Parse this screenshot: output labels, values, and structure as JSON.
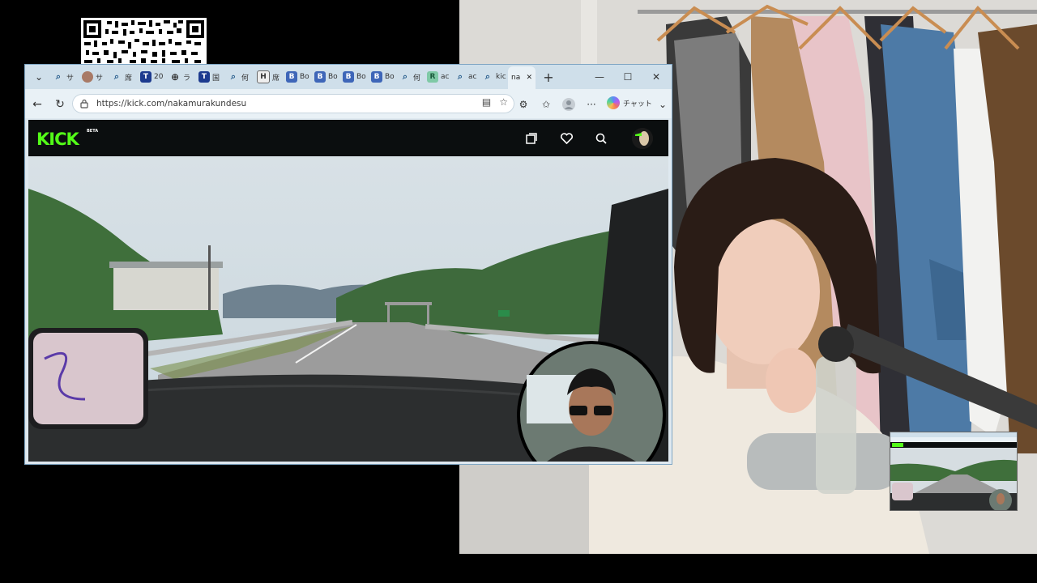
{
  "qr": {
    "icon": "qr-code-icon"
  },
  "browser": {
    "tabs": [
      {
        "icon": "search-icon",
        "label": "サ"
      },
      {
        "icon": "profile-icon",
        "label": "サ"
      },
      {
        "icon": "search-icon",
        "label": "席"
      },
      {
        "icon": "t-icon",
        "label": "20"
      },
      {
        "icon": "globe-icon",
        "label": "ラ"
      },
      {
        "icon": "t-icon",
        "label": "国"
      },
      {
        "icon": "search-icon",
        "label": "何"
      },
      {
        "icon": "h-icon",
        "label": "席"
      },
      {
        "icon": "b-icon",
        "label": "Bo"
      },
      {
        "icon": "b-icon",
        "label": "Bo"
      },
      {
        "icon": "b-icon",
        "label": "Bo"
      },
      {
        "icon": "b-icon",
        "label": "Bo"
      },
      {
        "icon": "search-icon",
        "label": "何"
      },
      {
        "icon": "r-icon",
        "label": "ac"
      },
      {
        "icon": "search-icon",
        "label": "ac"
      },
      {
        "icon": "search-icon",
        "label": "kic"
      }
    ],
    "active_tab": {
      "label": "na",
      "close": "✕"
    },
    "new_tab": "+",
    "window": {
      "minimize": "—",
      "maximize": "☐",
      "close": "✕"
    },
    "nav": {
      "back": "←",
      "refresh": "↻"
    },
    "address": {
      "url": "https://kick.com/nakamurakundesu"
    },
    "toolbar_right": {
      "more": "···",
      "copilot_label": "チャット",
      "chevron": "⌄"
    }
  },
  "kick": {
    "logo": "KICK",
    "beta": "BETA"
  },
  "colors": {
    "kick_green": "#53fc18",
    "tabstrip": "#cfdfea",
    "toolbar": "#e9f1f6"
  }
}
